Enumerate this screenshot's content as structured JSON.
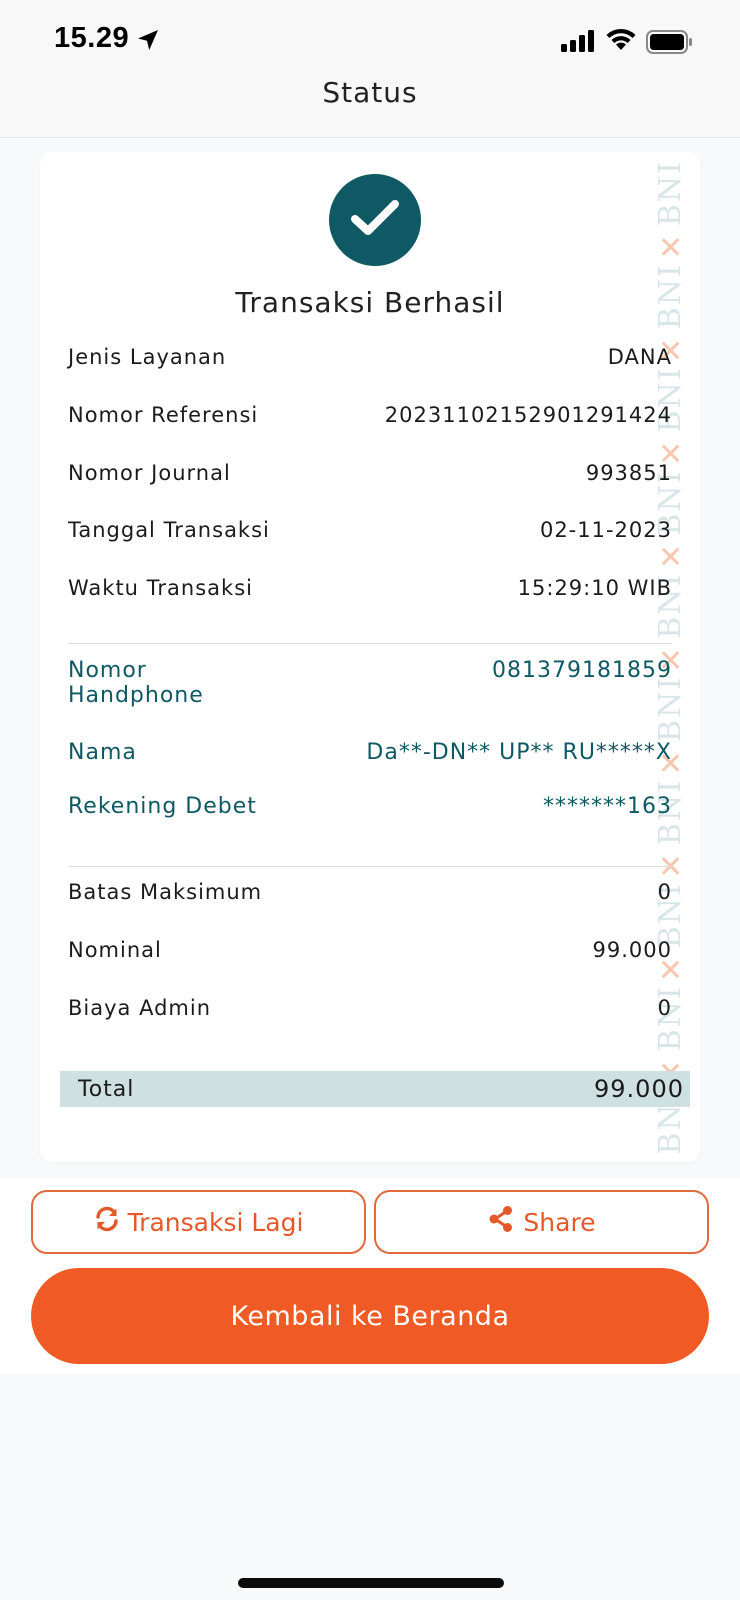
{
  "status_bar": {
    "time": "15.29",
    "icons": [
      "location-arrow-icon",
      "cellular-signal-icon",
      "wifi-icon",
      "battery-icon"
    ]
  },
  "header": {
    "title": "Status"
  },
  "result": {
    "icon": "checkmark-icon",
    "title": "Transaksi Berhasil"
  },
  "watermark": {
    "text": "BNI"
  },
  "details": [
    {
      "label": "Jenis Layanan",
      "value": "DANA"
    },
    {
      "label": "Nomor Referensi",
      "value": "20231102152901291424"
    },
    {
      "label": "Nomor Journal",
      "value": "993851"
    },
    {
      "label": "Tanggal Transaksi",
      "value": "02-11-2023"
    },
    {
      "label": "Waktu Transaksi",
      "value": "15:29:10 WIB"
    }
  ],
  "recipient": [
    {
      "label": "Nomor Handphone",
      "value": "081379181859"
    },
    {
      "label": "Nama",
      "value": "Da**-DN** UP** RU*****X"
    },
    {
      "label": "Rekening Debet",
      "value": "*******163"
    }
  ],
  "amounts": [
    {
      "label": "Batas Maksimum",
      "value": "0"
    },
    {
      "label": "Nominal",
      "value": "99.000"
    },
    {
      "label": "Biaya Admin",
      "value": "0"
    }
  ],
  "total": {
    "label": "Total",
    "value": "99.000"
  },
  "actions": {
    "again_label": "Transaksi Lagi",
    "again_icon": "refresh-icon",
    "share_label": "Share",
    "share_icon": "share-icon",
    "home_label": "Kembali ke Beranda"
  },
  "colors": {
    "accent": "#f05a24",
    "teal": "#0e5963",
    "total_bg": "#cfe0e2"
  }
}
